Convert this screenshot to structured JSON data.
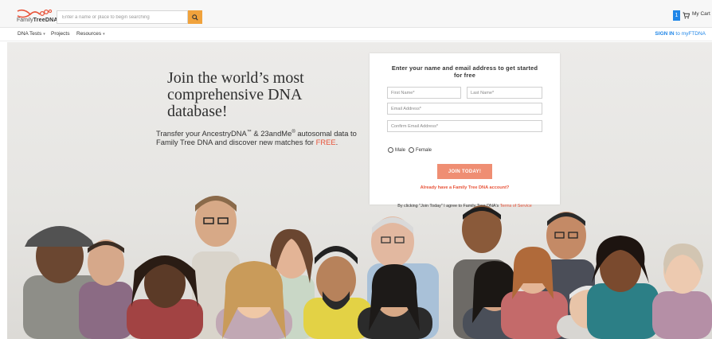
{
  "header": {
    "logo_text_light": "Family",
    "logo_text_bold": "TreeDNA",
    "search_placeholder": "Enter a name or place to begin searching",
    "cart_count": "1",
    "cart_label": "My Cart",
    "accent_color": "#f0a23c",
    "cart_badge_color": "#1f86e8"
  },
  "nav": {
    "items": [
      {
        "label": "DNA Tests",
        "has_dropdown": true
      },
      {
        "label": "Projects",
        "has_dropdown": false
      },
      {
        "label": "Resources",
        "has_dropdown": true
      }
    ],
    "signin_bold": "SIGN IN",
    "signin_rest": " to myFTDNA"
  },
  "hero": {
    "headline": "Join the world’s most comprehensive DNA database!",
    "sub_part1": "Transfer your AncestryDNA",
    "sub_tm": "™",
    "sub_part2": " & 23andMe",
    "sub_reg": "®",
    "sub_part3": " autosomal data to Family Tree DNA and discover new matches for ",
    "sub_free": "FREE",
    "sub_end": "."
  },
  "form": {
    "title": "Enter your name and email address to get started for free",
    "first_name_placeholder": "First Name*",
    "last_name_placeholder": "Last Name*",
    "email_placeholder": "Email Address*",
    "confirm_email_placeholder": "Confirm Email Address*",
    "gender_options": [
      "Male",
      "Female"
    ],
    "submit_label": "JOIN TODAY!",
    "have_account_link": "Already have a Family Tree DNA account?",
    "terms_prefix": "By clicking \"Join Today\" I agree to Family Tree DNA's ",
    "terms_link": "Terms of Service",
    "button_color": "#ef8e73",
    "link_color": "#e8543a"
  }
}
